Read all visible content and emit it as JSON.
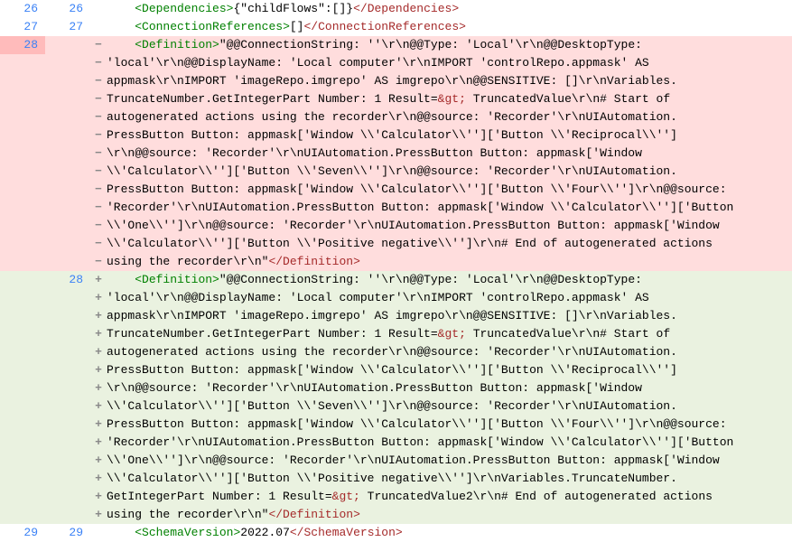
{
  "rows": [
    {
      "cls": "row-ctx",
      "old": "26",
      "new": "26",
      "marker": "",
      "segments": [
        {
          "t": "    <",
          "c": "tag"
        },
        {
          "t": "Dependencies",
          "c": "tag"
        },
        {
          "t": ">",
          "c": "tag"
        },
        {
          "t": "{\"childFlows\":[]}",
          "c": "str-black"
        },
        {
          "t": "</",
          "c": "brown"
        },
        {
          "t": "Dependencies",
          "c": "brown"
        },
        {
          "t": ">",
          "c": "brown"
        }
      ]
    },
    {
      "cls": "row-ctx",
      "old": "27",
      "new": "27",
      "marker": "",
      "segments": [
        {
          "t": "    <",
          "c": "tag"
        },
        {
          "t": "ConnectionReferences",
          "c": "tag"
        },
        {
          "t": ">",
          "c": "tag"
        },
        {
          "t": "[]",
          "c": "str-black"
        },
        {
          "t": "</",
          "c": "brown"
        },
        {
          "t": "ConnectionReferences",
          "c": "brown"
        },
        {
          "t": ">",
          "c": "brown"
        }
      ]
    },
    {
      "cls": "row-del row-del-first",
      "old": "28",
      "new": "",
      "marker": "−",
      "segments": [
        {
          "t": "    <",
          "c": "tag"
        },
        {
          "t": "Definition",
          "c": "tag"
        },
        {
          "t": ">",
          "c": "tag"
        },
        {
          "t": "\"@@ConnectionString: ''\\r\\n@@Type: 'Local'\\r\\n@@DesktopType: ",
          "c": "str-black"
        }
      ]
    },
    {
      "cls": "row-del",
      "old": "",
      "new": "",
      "marker": "−",
      "segments": [
        {
          "t": "'local'\\r\\n@@DisplayName: 'Local computer'\\r\\nIMPORT 'controlRepo.appmask' AS ",
          "c": "str-black"
        }
      ]
    },
    {
      "cls": "row-del",
      "old": "",
      "new": "",
      "marker": "−",
      "segments": [
        {
          "t": "appmask\\r\\nIMPORT 'imageRepo.imgrepo' AS imgrepo\\r\\n@@SENSITIVE: []\\r\\nVariables.",
          "c": "str-black"
        }
      ]
    },
    {
      "cls": "row-del",
      "old": "",
      "new": "",
      "marker": "−",
      "segments": [
        {
          "t": "TruncateNumber.GetIntegerPart Number: 1 Result=",
          "c": "str-black"
        },
        {
          "t": "&gt;",
          "c": "amp"
        },
        {
          "t": " TruncatedValue\\r\\n# Start of ",
          "c": "str-black"
        }
      ]
    },
    {
      "cls": "row-del",
      "old": "",
      "new": "",
      "marker": "−",
      "segments": [
        {
          "t": "autogenerated actions using the recorder\\r\\n@@source: 'Recorder'\\r\\nUIAutomation.",
          "c": "str-black"
        }
      ]
    },
    {
      "cls": "row-del",
      "old": "",
      "new": "",
      "marker": "−",
      "segments": [
        {
          "t": "PressButton Button: appmask['Window \\\\'Calculator\\\\'']['Button \\\\'Reciprocal\\\\'']",
          "c": "str-black"
        }
      ]
    },
    {
      "cls": "row-del",
      "old": "",
      "new": "",
      "marker": "−",
      "segments": [
        {
          "t": "\\r\\n@@source: 'Recorder'\\r\\nUIAutomation.PressButton Button: appmask['Window ",
          "c": "str-black"
        }
      ]
    },
    {
      "cls": "row-del",
      "old": "",
      "new": "",
      "marker": "−",
      "segments": [
        {
          "t": "\\\\'Calculator\\\\'']['Button \\\\'Seven\\\\'']\\r\\n@@source: 'Recorder'\\r\\nUIAutomation.",
          "c": "str-black"
        }
      ]
    },
    {
      "cls": "row-del",
      "old": "",
      "new": "",
      "marker": "−",
      "segments": [
        {
          "t": "PressButton Button: appmask['Window \\\\'Calculator\\\\'']['Button \\\\'Four\\\\'']\\r\\n@@source: ",
          "c": "str-black"
        }
      ]
    },
    {
      "cls": "row-del",
      "old": "",
      "new": "",
      "marker": "−",
      "segments": [
        {
          "t": "'Recorder'\\r\\nUIAutomation.PressButton Button: appmask['Window \\\\'Calculator\\\\'']['Button ",
          "c": "str-black"
        }
      ]
    },
    {
      "cls": "row-del",
      "old": "",
      "new": "",
      "marker": "−",
      "segments": [
        {
          "t": "\\\\'One\\\\'']\\r\\n@@source: 'Recorder'\\r\\nUIAutomation.PressButton Button: appmask['Window ",
          "c": "str-black"
        }
      ]
    },
    {
      "cls": "row-del",
      "old": "",
      "new": "",
      "marker": "−",
      "segments": [
        {
          "t": "\\\\'Calculator\\\\'']['Button \\\\'Positive negative\\\\'']\\r\\n# End of autogenerated actions ",
          "c": "str-black"
        }
      ]
    },
    {
      "cls": "row-del",
      "old": "",
      "new": "",
      "marker": "−",
      "segments": [
        {
          "t": "using the recorder\\r\\n\"",
          "c": "str-black"
        },
        {
          "t": "</",
          "c": "brown"
        },
        {
          "t": "Definition",
          "c": "brown"
        },
        {
          "t": ">",
          "c": "brown"
        }
      ]
    },
    {
      "cls": "row-add",
      "old": "",
      "new": "28",
      "marker": "+",
      "segments": [
        {
          "t": "    <",
          "c": "tag"
        },
        {
          "t": "Definition",
          "c": "tag"
        },
        {
          "t": ">",
          "c": "tag"
        },
        {
          "t": "\"@@ConnectionString: ''\\r\\n@@Type: 'Local'\\r\\n@@DesktopType: ",
          "c": "str-black"
        }
      ]
    },
    {
      "cls": "row-add",
      "old": "",
      "new": "",
      "marker": "+",
      "segments": [
        {
          "t": "'local'\\r\\n@@DisplayName: 'Local computer'\\r\\nIMPORT 'controlRepo.appmask' AS ",
          "c": "str-black"
        }
      ]
    },
    {
      "cls": "row-add",
      "old": "",
      "new": "",
      "marker": "+",
      "segments": [
        {
          "t": "appmask\\r\\nIMPORT 'imageRepo.imgrepo' AS imgrepo\\r\\n@@SENSITIVE: []\\r\\nVariables.",
          "c": "str-black"
        }
      ]
    },
    {
      "cls": "row-add",
      "old": "",
      "new": "",
      "marker": "+",
      "segments": [
        {
          "t": "TruncateNumber.GetIntegerPart Number: 1 Result=",
          "c": "str-black"
        },
        {
          "t": "&gt;",
          "c": "amp"
        },
        {
          "t": " TruncatedValue\\r\\n# Start of ",
          "c": "str-black"
        }
      ]
    },
    {
      "cls": "row-add",
      "old": "",
      "new": "",
      "marker": "+",
      "segments": [
        {
          "t": "autogenerated actions using the recorder\\r\\n@@source: 'Recorder'\\r\\nUIAutomation.",
          "c": "str-black"
        }
      ]
    },
    {
      "cls": "row-add",
      "old": "",
      "new": "",
      "marker": "+",
      "segments": [
        {
          "t": "PressButton Button: appmask['Window \\\\'Calculator\\\\'']['Button \\\\'Reciprocal\\\\'']",
          "c": "str-black"
        }
      ]
    },
    {
      "cls": "row-add",
      "old": "",
      "new": "",
      "marker": "+",
      "segments": [
        {
          "t": "\\r\\n@@source: 'Recorder'\\r\\nUIAutomation.PressButton Button: appmask['Window ",
          "c": "str-black"
        }
      ]
    },
    {
      "cls": "row-add",
      "old": "",
      "new": "",
      "marker": "+",
      "segments": [
        {
          "t": "\\\\'Calculator\\\\'']['Button \\\\'Seven\\\\'']\\r\\n@@source: 'Recorder'\\r\\nUIAutomation.",
          "c": "str-black"
        }
      ]
    },
    {
      "cls": "row-add",
      "old": "",
      "new": "",
      "marker": "+",
      "segments": [
        {
          "t": "PressButton Button: appmask['Window \\\\'Calculator\\\\'']['Button \\\\'Four\\\\'']\\r\\n@@source: ",
          "c": "str-black"
        }
      ]
    },
    {
      "cls": "row-add",
      "old": "",
      "new": "",
      "marker": "+",
      "segments": [
        {
          "t": "'Recorder'\\r\\nUIAutomation.PressButton Button: appmask['Window \\\\'Calculator\\\\'']['Button ",
          "c": "str-black"
        }
      ]
    },
    {
      "cls": "row-add",
      "old": "",
      "new": "",
      "marker": "+",
      "segments": [
        {
          "t": "\\\\'One\\\\'']\\r\\n@@source: 'Recorder'\\r\\nUIAutomation.PressButton Button: appmask['Window ",
          "c": "str-black"
        }
      ]
    },
    {
      "cls": "row-add",
      "old": "",
      "new": "",
      "marker": "+",
      "segments": [
        {
          "t": "\\\\'Calculator\\\\'']['Button \\\\'Positive negative\\\\'']\\r\\nVariables.TruncateNumber.",
          "c": "str-black"
        }
      ]
    },
    {
      "cls": "row-add",
      "old": "",
      "new": "",
      "marker": "+",
      "segments": [
        {
          "t": "GetIntegerPart Number: 1 Result=",
          "c": "str-black"
        },
        {
          "t": "&gt;",
          "c": "amp"
        },
        {
          "t": " TruncatedValue2\\r\\n# End of autogenerated actions ",
          "c": "str-black"
        }
      ]
    },
    {
      "cls": "row-add",
      "old": "",
      "new": "",
      "marker": "+",
      "segments": [
        {
          "t": "using the recorder\\r\\n\"",
          "c": "str-black"
        },
        {
          "t": "</",
          "c": "brown"
        },
        {
          "t": "Definition",
          "c": "brown"
        },
        {
          "t": ">",
          "c": "brown"
        }
      ]
    },
    {
      "cls": "row-ctx",
      "old": "29",
      "new": "29",
      "marker": "",
      "segments": [
        {
          "t": "    <",
          "c": "tag"
        },
        {
          "t": "SchemaVersion",
          "c": "tag"
        },
        {
          "t": ">",
          "c": "tag"
        },
        {
          "t": "2022.07",
          "c": "str-black"
        },
        {
          "t": "</",
          "c": "brown"
        },
        {
          "t": "SchemaVersion",
          "c": "brown"
        },
        {
          "t": ">",
          "c": "brown"
        }
      ]
    }
  ]
}
